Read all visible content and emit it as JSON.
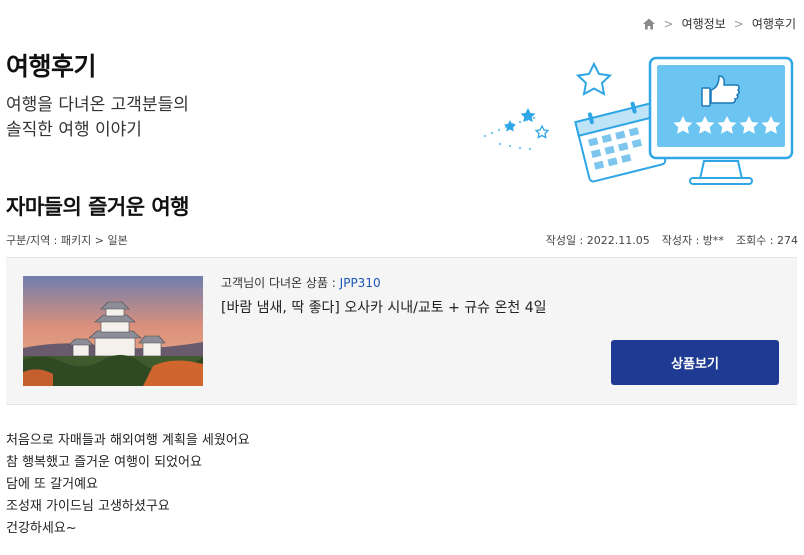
{
  "breadcrumb": {
    "home_icon": "home-icon",
    "items": [
      "여행정보",
      "여행후기"
    ]
  },
  "header": {
    "title": "여행후기",
    "subtitle_line1": "여행을 다녀온 고객분들의",
    "subtitle_line2": "솔직한 여행 이야기"
  },
  "post": {
    "title": "자마들의 즐거운 여행",
    "category": "구분/지역 : 패키지 > 일본",
    "date": "작성일 : 2022.11.05",
    "author": "작성자 : 방**",
    "views": "조회수 : 274"
  },
  "product": {
    "code_label": "고객님이 다녀온 상품 : ",
    "code": "JPP310",
    "name": "[바람 냄새, 딱 좋다] 오사카 시내/교토 + 규슈 온천 4일",
    "button_label": "상품보기",
    "image_icon": "castle-photo"
  },
  "content": {
    "lines": [
      "처음으로 자매들과 해외여행 계획을 세웠어요",
      "참 행복했고 즐거운 여행이 되었어요",
      "담에 또 갈거예요",
      "조성재 가이드님 고생하셨구요",
      "건강하세요~"
    ]
  },
  "colors": {
    "accent": "#1f3a93",
    "code_link": "#1a55b8",
    "illustration": "#2fa6e6"
  }
}
